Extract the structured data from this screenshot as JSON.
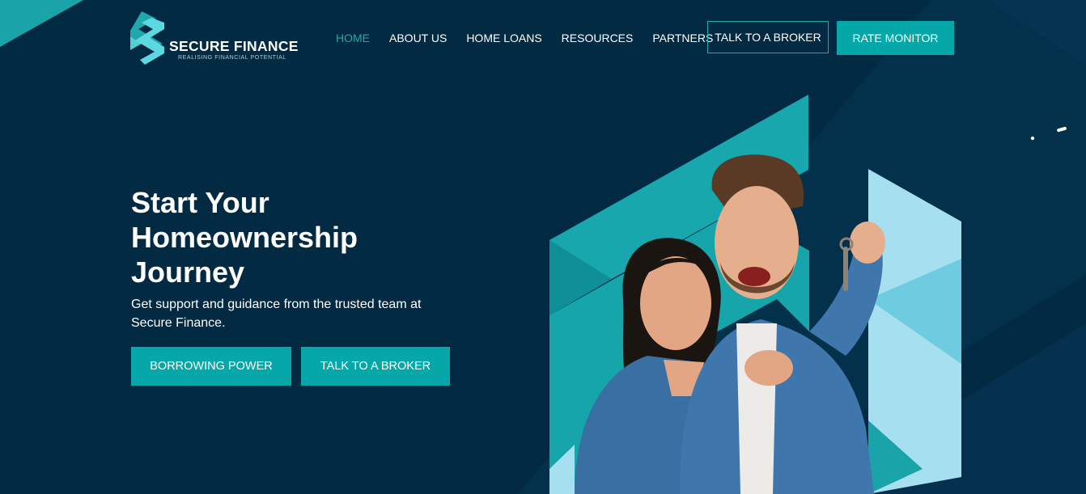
{
  "brand": {
    "name": "SECURE FINANCE",
    "tagline": "REALISING FINANCIAL POTENTIAL"
  },
  "nav": {
    "items": [
      {
        "label": "HOME",
        "active": true
      },
      {
        "label": "ABOUT US",
        "active": false
      },
      {
        "label": "HOME LOANS",
        "active": false
      },
      {
        "label": "RESOURCES",
        "active": false
      },
      {
        "label": "PARTNERS",
        "active": false
      }
    ],
    "talk_to_broker": "TALK TO A BROKER",
    "rate_monitor": "RATE MONITOR"
  },
  "hero": {
    "title": "Start Your Homeownership Journey",
    "subtitle": "Get support and guidance from the trusted team at Secure Finance.",
    "borrowing_power": "BORROWING POWER",
    "talk_to_broker": "TALK TO A BROKER"
  },
  "colors": {
    "background": "#022a42",
    "accent": "#05a7a8",
    "light_accent": "#a6dff0"
  },
  "icons": {
    "logo": "secure-finance-s-logo"
  }
}
